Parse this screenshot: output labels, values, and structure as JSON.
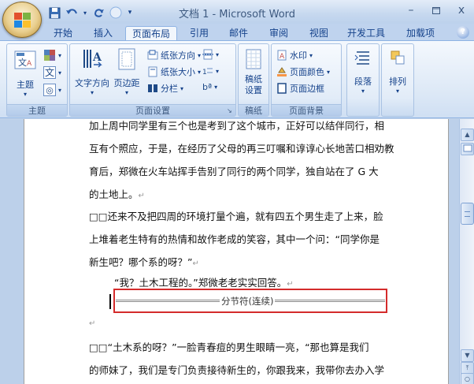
{
  "window": {
    "title": "文档 1 - Microsoft Word",
    "minimize": "–",
    "maximize": "□",
    "close": "x"
  },
  "qat": {
    "save": "💾",
    "undo": "↶",
    "redo": "↷",
    "more": "▾"
  },
  "tabs": [
    {
      "label": "开始"
    },
    {
      "label": "插入"
    },
    {
      "label": "页面布局"
    },
    {
      "label": "引用"
    },
    {
      "label": "邮件"
    },
    {
      "label": "审阅"
    },
    {
      "label": "视图"
    },
    {
      "label": "开发工具"
    },
    {
      "label": "加载项"
    }
  ],
  "help_label": "?",
  "ribbon": {
    "theme_group": {
      "label": "主题",
      "btn_theme": "主题",
      "color_glyph": "▆",
      "font_glyph": "文",
      "effect_glyph": "◎"
    },
    "page_setup": {
      "label": "页面设置",
      "text_direction": "文字方向",
      "margins": "页边距",
      "orientation": "纸张方向",
      "size": "纸张大小",
      "columns": "分栏",
      "breaks_glyph": "⁚",
      "line_numbers_glyph": "1⁚",
      "hyphen_glyph": "bª"
    },
    "manuscript": {
      "label": "稿纸",
      "btn": "稿纸\n设置",
      "line1": "稿纸",
      "line2": "设置"
    },
    "page_bg": {
      "label": "页面背景",
      "watermark": "水印",
      "page_color": "页面颜色",
      "page_border": "页面边框"
    },
    "paragraph_btn": "段落",
    "arrange_btn": "排列"
  },
  "document": {
    "lines": [
      "加上周中同学里有三个也是考到了这个城市，正好可以结伴同行，相",
      "互有个照应，于是，在经历了父母的再三叮嘱和谆谆心长地苦口相劝教",
      "育后，郑微在火车站挥手告别了同行的两个同学，独自站在了 G 大",
      "的土地上。"
    ],
    "para2_line1": "□□还来不及把四周的环境打量个遍，就有四五个男生走了上来，脸",
    "para2_line2": "上堆着老生特有的热情和故作老成的笑容，其中一个问：“同学你是",
    "para2_line3": "新生吧？哪个系的呀？”",
    "para3": "“我？土木工程的。”郑微老老实实回答。",
    "section_break": "分节符(连续)",
    "para4_line1": "□□“土木系的呀？”一脸青春痘的男生眼睛一亮，“那也算是我们",
    "para4_line2": "的师妹了，我们是专门负责接待新生的，你跟我来，我带你去办入学",
    "para_mark": "↵"
  }
}
